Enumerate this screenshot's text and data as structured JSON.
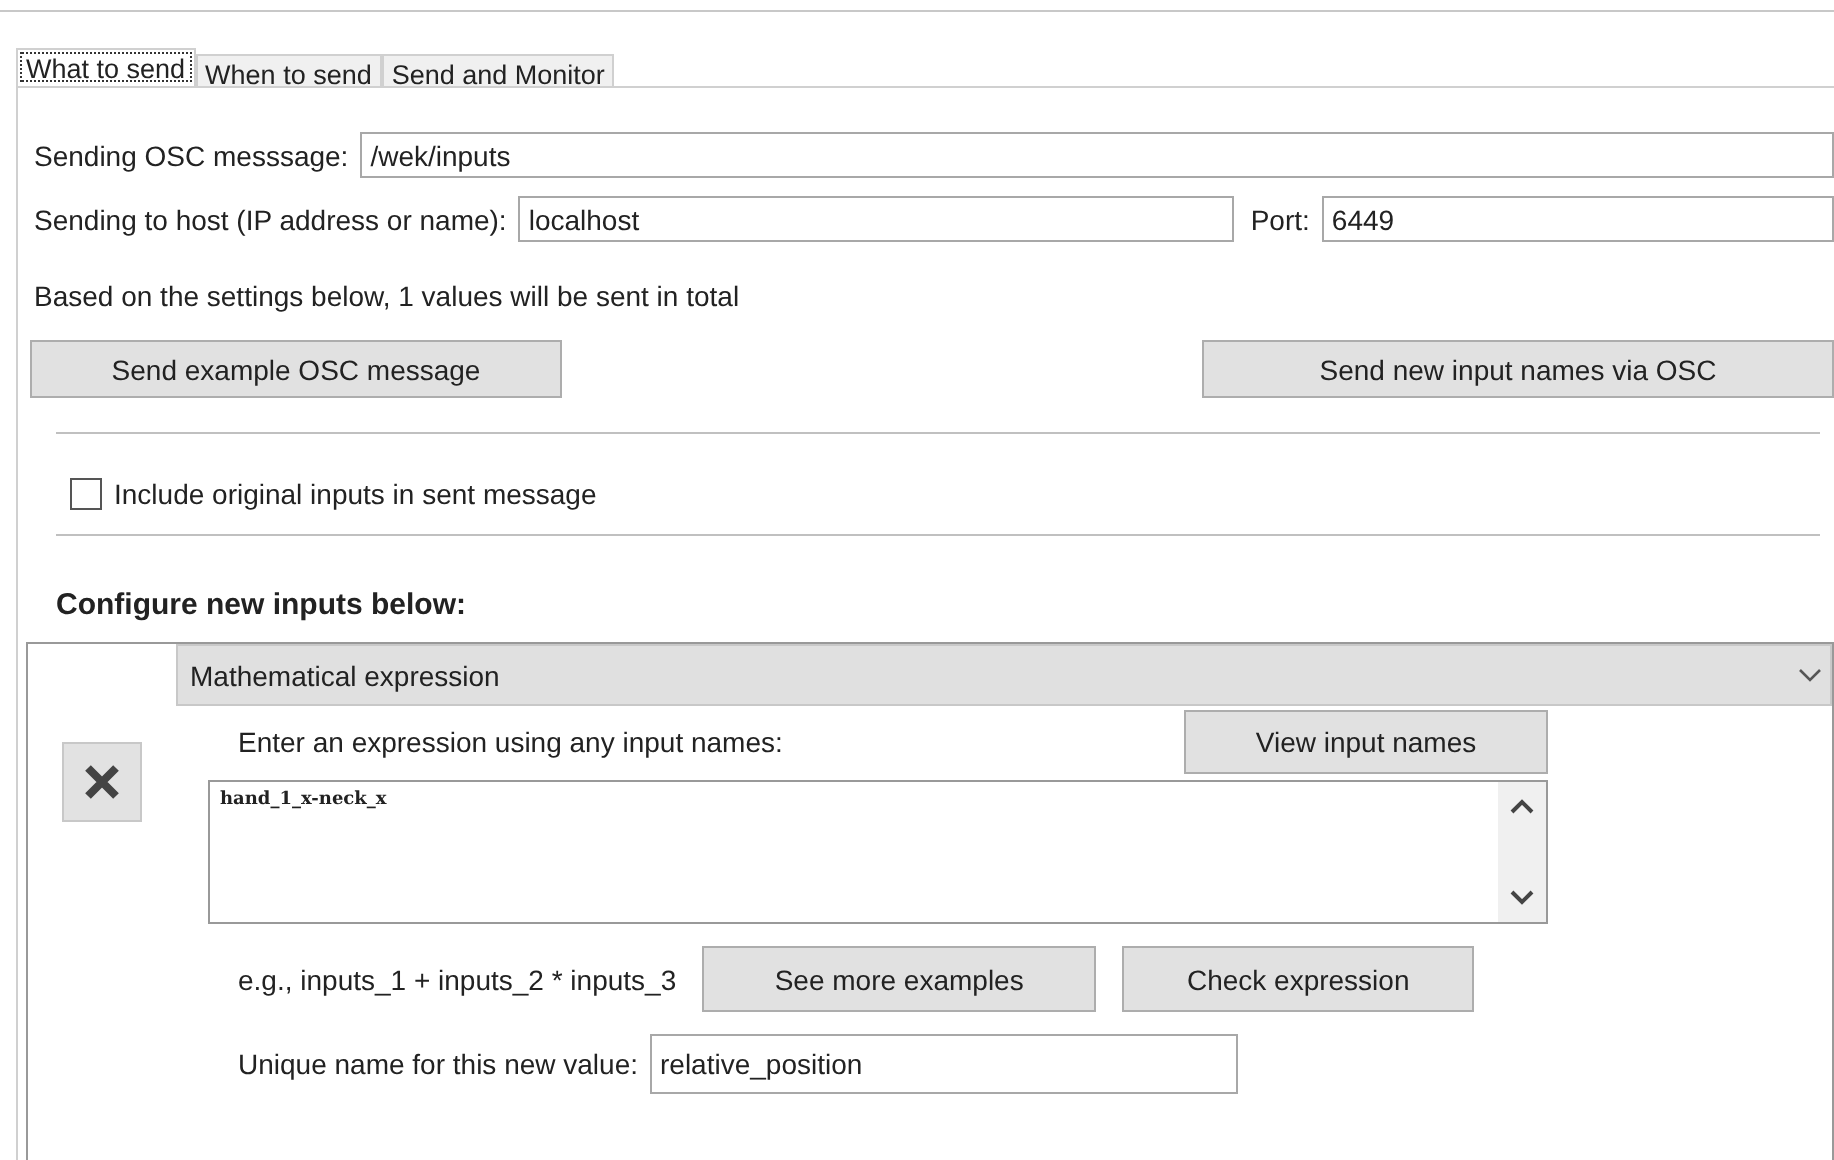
{
  "tabs": [
    {
      "label": "What to send",
      "selected": true
    },
    {
      "label": "When to send",
      "selected": false
    },
    {
      "label": "Send and Monitor",
      "selected": false
    }
  ],
  "osc_message": {
    "label": "Sending OSC messsage:",
    "value": "/wek/inputs"
  },
  "host": {
    "label": "Sending to host (IP address or name):",
    "value": "localhost"
  },
  "port": {
    "label": "Port:",
    "value": "6449"
  },
  "summary": "Based on the settings below, 1 values will be sent in total",
  "send_example_button": "Send example OSC message",
  "send_names_button": "Send new input names via OSC",
  "include_original": {
    "label": "Include original inputs in sent message",
    "checked": false
  },
  "configure_heading": "Configure new inputs below:",
  "new_input": {
    "type": "Mathematical expression",
    "prompt": "Enter an expression using any input names:",
    "view_names_button": "View input names",
    "expression": "hand_1_x-neck_x",
    "example": "e.g., inputs_1 + inputs_2 * inputs_3",
    "see_examples_button": "See more examples",
    "check_button": "Check expression",
    "name_label": "Unique name for this new value:",
    "name_value": "relative_position"
  }
}
